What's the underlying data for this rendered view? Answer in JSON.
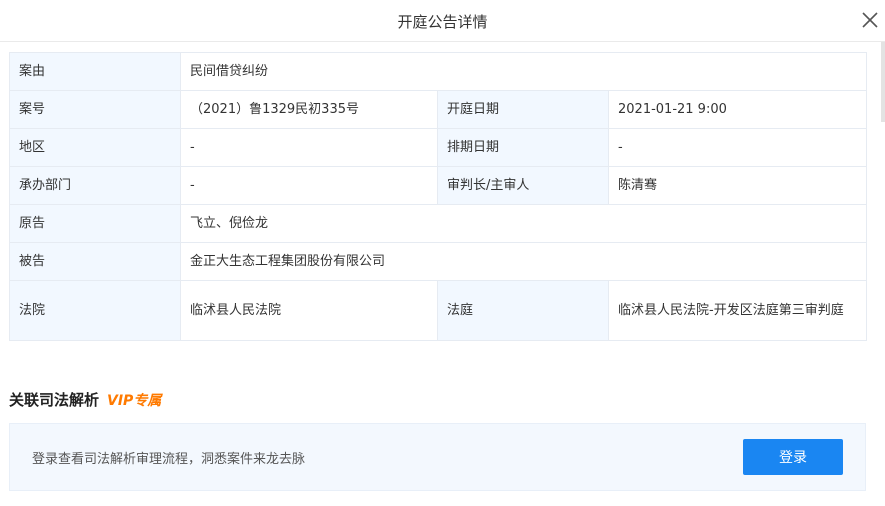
{
  "dialog": {
    "title": "开庭公告详情"
  },
  "detail": {
    "case_reason_label": "案由",
    "case_reason_value": "民间借贷纠纷",
    "case_no_label": "案号",
    "case_no_value": "（2021）鲁1329民初335号",
    "hearing_date_label": "开庭日期",
    "hearing_date_value": "2021-01-21 9:00",
    "region_label": "地区",
    "region_value": "-",
    "schedule_date_label": "排期日期",
    "schedule_date_value": "-",
    "department_label": "承办部门",
    "department_value": "-",
    "judge_label": "审判长/主审人",
    "judge_value": "陈清骞",
    "plaintiff_label": "原告",
    "plaintiff_value": "飞立、倪俭龙",
    "defendant_label": "被告",
    "defendant_value": "金正大生态工程集团股份有限公司",
    "court_label": "法院",
    "court_value": "临沭县人民法院",
    "courtroom_label": "法庭",
    "courtroom_value": "临沭县人民法院-开发区法庭第三审判庭"
  },
  "analysis": {
    "title": "关联司法解析",
    "vip_badge": "VIP专属",
    "prompt": "登录查看司法解析审理流程，洞悉案件来龙去脉",
    "login_label": "登录"
  },
  "colors": {
    "label_bg": "#f2f8ff",
    "accent_blue": "#1a86f2",
    "vip_orange": "#ff7a00"
  }
}
